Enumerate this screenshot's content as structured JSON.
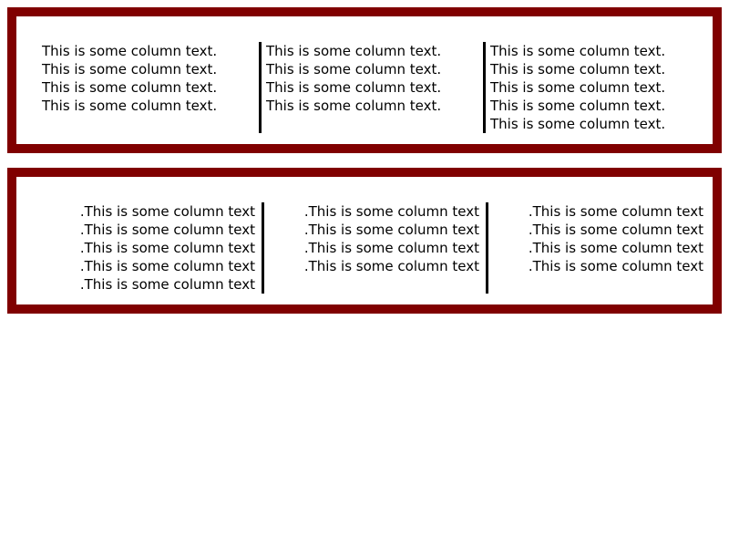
{
  "colors": {
    "border": "#800000",
    "rule": "#000000",
    "background": "#ffffff",
    "text": "#000000"
  },
  "top_section": {
    "columns": [
      {
        "lines": [
          "This is some column text.",
          "This is some column text.",
          "This is some column text.",
          "This is some column text."
        ]
      },
      {
        "lines": [
          "This is some column text.",
          "This is some column text.",
          "This is some column text.",
          "This is some column text."
        ]
      },
      {
        "lines": [
          "This is some column text.",
          "This is some column text.",
          "This is some column text.",
          "This is some column text.",
          "This is some column text."
        ]
      }
    ]
  },
  "bottom_section": {
    "columns": [
      {
        "lines": [
          ".This is some column text",
          ".This is some column text",
          ".This is some column text",
          ".This is some column text",
          ".This is some column text"
        ]
      },
      {
        "lines": [
          ".This is some column text",
          ".This is some column text",
          ".This is some column text",
          ".This is some column text"
        ]
      },
      {
        "lines": [
          ".This is some column text",
          ".This is some column text",
          ".This is some column text",
          ".This is some column text"
        ]
      }
    ]
  }
}
